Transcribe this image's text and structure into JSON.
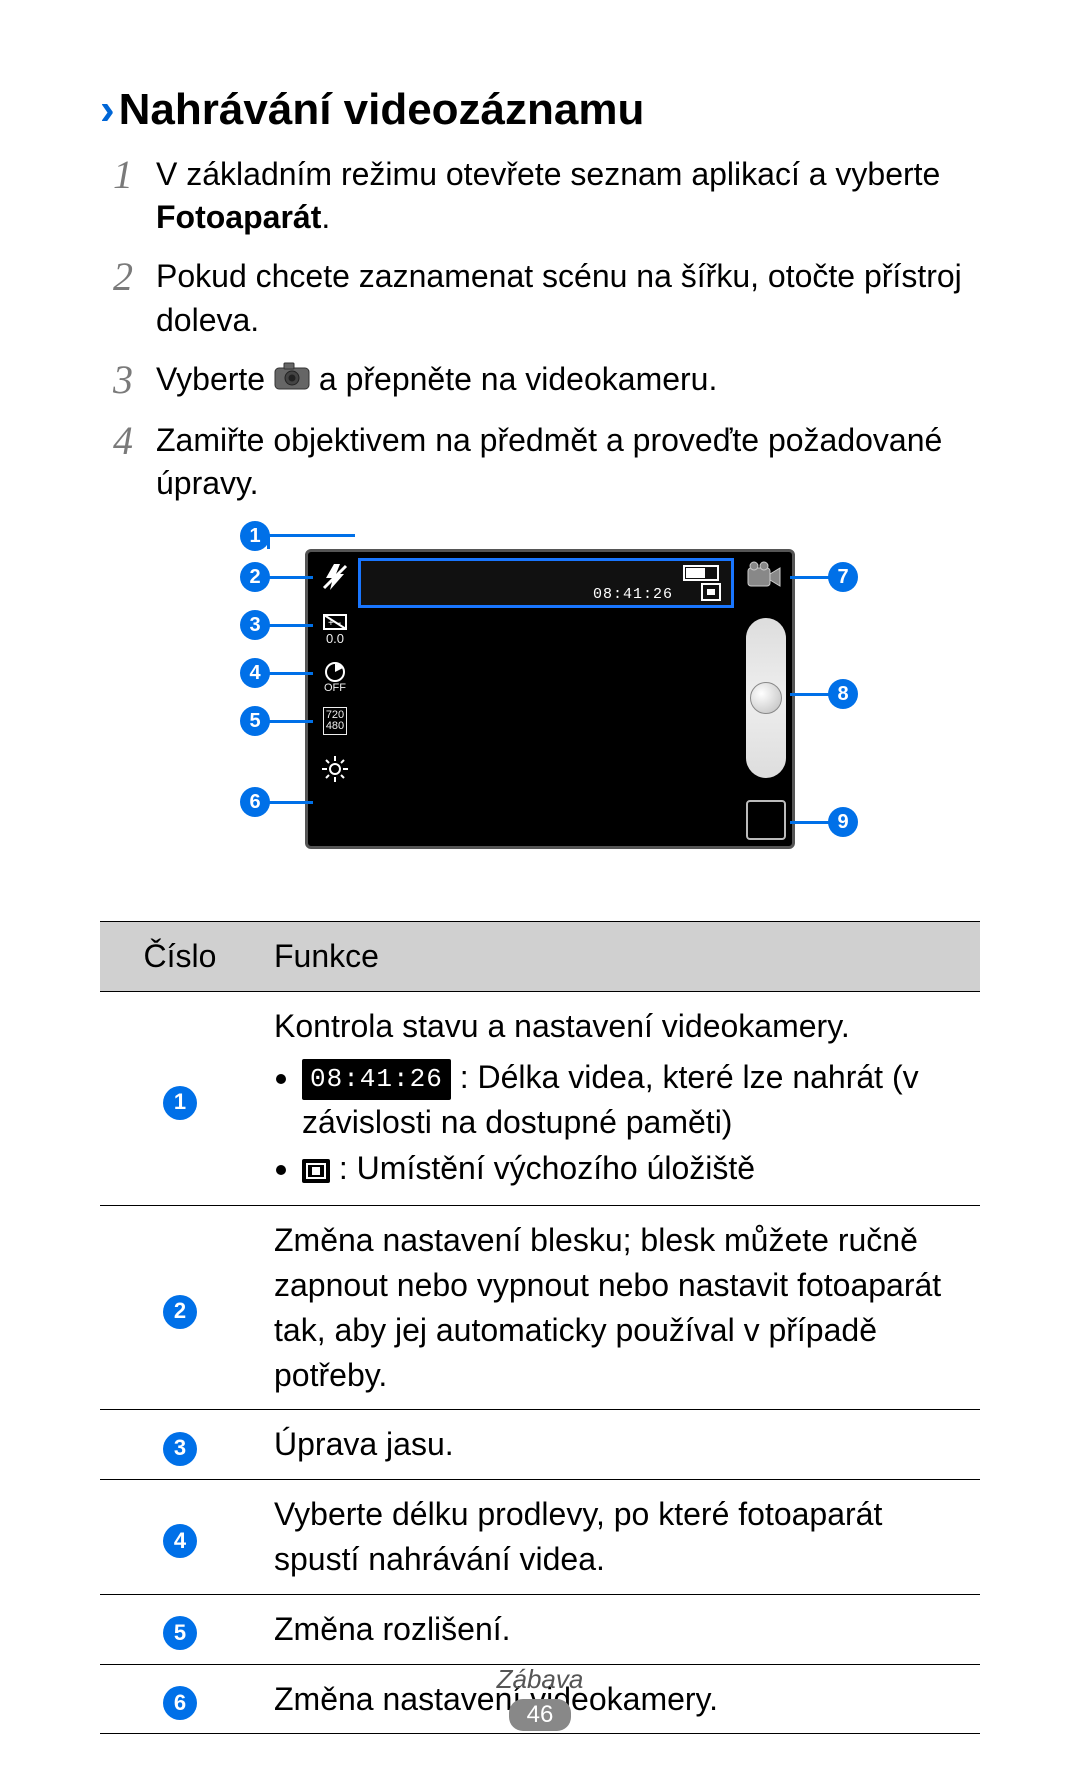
{
  "heading": "Nahrávání videozáznamu",
  "steps": [
    {
      "num": "1",
      "text_a": "V základním režimu otevřete seznam aplikací a vyberte ",
      "bold": "Fotoaparát",
      "text_b": "."
    },
    {
      "num": "2",
      "text_a": "Pokud chcete zaznamenat scénu na šířku, otočte přístroj doleva."
    },
    {
      "num": "3",
      "text_a": "Vyberte ",
      "icon": "camera",
      "text_b": " a přepněte na videokameru."
    },
    {
      "num": "4",
      "text_a": "Zamiřte objektivem na předmět a proveďte požadované úpravy."
    }
  ],
  "diagram": {
    "time": "08:41:26",
    "ev": "0.0",
    "timer": "OFF",
    "resolution_top": "720",
    "resolution_bottom": "480",
    "callouts": [
      "1",
      "2",
      "3",
      "4",
      "5",
      "6",
      "7",
      "8",
      "9"
    ]
  },
  "table": {
    "header": {
      "col1": "Číslo",
      "col2": "Funkce"
    },
    "rows": [
      {
        "num": "1",
        "main": "Kontrola stavu a nastavení videokamery.",
        "bullets": [
          {
            "type": "time",
            "badge": "08:41:26",
            "text": " : Délka videa, které lze nahrát (v závislosti na dostupné paměti)"
          },
          {
            "type": "storage",
            "text": " : Umístění výchozího úložiště"
          }
        ]
      },
      {
        "num": "2",
        "main": "Změna nastavení blesku; blesk můžete ručně zapnout nebo vypnout nebo nastavit fotoaparát tak, aby jej automaticky používal v případě potřeby."
      },
      {
        "num": "3",
        "main": "Úprava jasu."
      },
      {
        "num": "4",
        "main": "Vyberte délku prodlevy, po které fotoaparát spustí nahrávání videa."
      },
      {
        "num": "5",
        "main": "Změna rozlišení."
      },
      {
        "num": "6",
        "main": "Změna nastavení videokamery."
      }
    ]
  },
  "footer": {
    "section": "Zábava",
    "page": "46"
  }
}
